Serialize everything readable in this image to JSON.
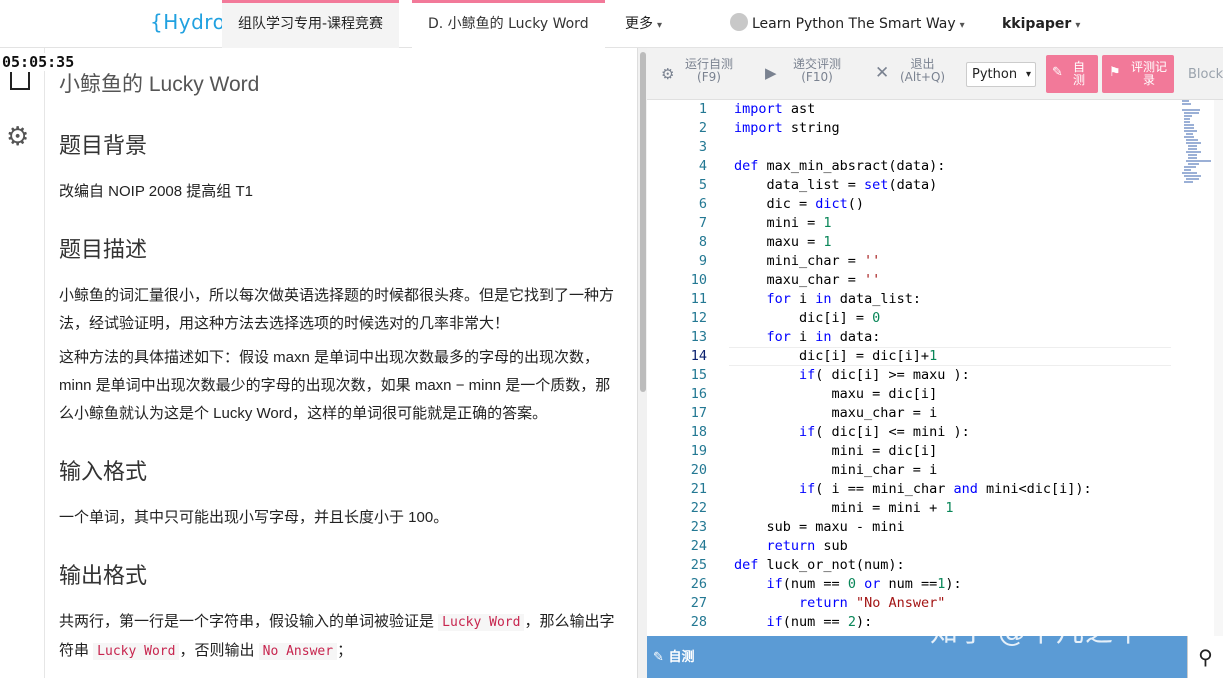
{
  "nav": {
    "logo": "{Hydro}",
    "items": [
      {
        "label": "组队学习专用-课程竞赛"
      },
      {
        "label": "D. 小鲸鱼的 Lucky Word"
      },
      {
        "label": "更多"
      },
      {
        "label": "Learn Python The Smart Way"
      },
      {
        "label": "kkipaper"
      }
    ]
  },
  "timer": "05:05:35",
  "problem": {
    "title": "小鲸鱼的 Lucky Word",
    "sections": {
      "background": {
        "heading": "题目背景",
        "text": "改编自 NOIP 2008 提高组 T1"
      },
      "description": {
        "heading": "题目描述",
        "p1": "小鲸鱼的词汇量很小，所以每次做英语选择题的时候都很头疼。但是它找到了一种方法，经试验证明，用这种方法去选择选项的时候选对的几率非常大！",
        "p2": "这种方法的具体描述如下：假设 maxn 是单词中出现次数最多的字母的出现次数，minn 是单词中出现次数最少的字母的出现次数，如果 maxn − minn 是一个质数，那么小鲸鱼就认为这是个 Lucky Word，这样的单词很可能就是正确的答案。"
      },
      "input": {
        "heading": "输入格式",
        "text": "一个单词，其中只可能出现小写字母，并且长度小于 100。"
      },
      "output": {
        "heading": "输出格式",
        "t1": "共两行，第一行是一个字符串，假设输入的单词被验证是 ",
        "c1": "Lucky Word",
        "t2": "，那么输出字符串 ",
        "c2": "Lucky Word",
        "t3": "，否则输出 ",
        "c3": "No Answer",
        "t4": "；"
      }
    }
  },
  "toolbar": {
    "run_label": "运行自测",
    "run_key": "(F9)",
    "submit_label": "递交评测",
    "submit_key": "(F10)",
    "exit_label": "退出",
    "exit_key": "(Alt+Q)",
    "language": "Python",
    "selftest_label": "自测",
    "records_label": "评测记录",
    "blockly_label": "Blockl"
  },
  "editor": {
    "current_line": 14,
    "lines": [
      "import ast",
      "import string",
      "",
      "def max_min_absract(data):",
      "    data_list = set(data)",
      "    dic = dict()",
      "    mini = 1",
      "    maxu = 1",
      "    mini_char = ''",
      "    maxu_char = ''",
      "    for i in data_list:",
      "        dic[i] = 0",
      "    for i in data:",
      "        dic[i] = dic[i]+1",
      "        if( dic[i] >= maxu ):",
      "            maxu = dic[i]",
      "            maxu_char = i",
      "        if( dic[i] <= mini ):",
      "            mini = dic[i]",
      "            mini_char = i",
      "        if( i == mini_char and mini<dic[i]):",
      "            mini = mini + 1",
      "    sub = maxu - mini",
      "    return sub",
      "def luck_or_not(num):",
      "    if(num == 0 or num ==1):",
      "        return \"No Answer\"",
      "    if(num == 2):"
    ]
  },
  "bottom": {
    "label": "自测"
  },
  "watermark": "知乎 @平凡之牛",
  "colors": {
    "accent": "#f27999",
    "keyword": "#0000ff",
    "number": "#098658",
    "string": "#a31515",
    "linenum": "#237893",
    "bottombar": "#5b9bd5"
  }
}
